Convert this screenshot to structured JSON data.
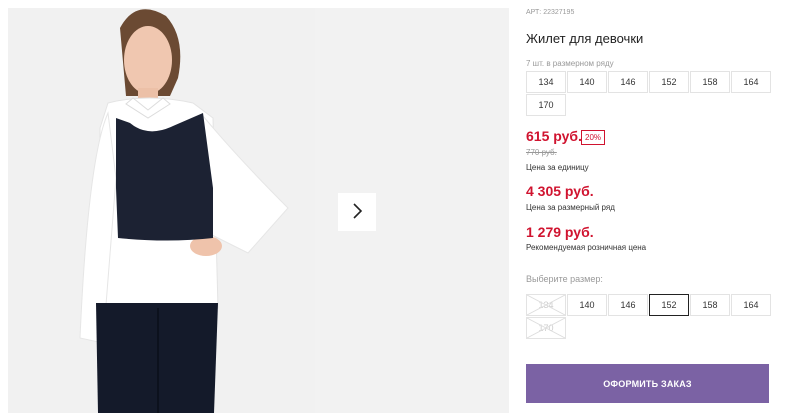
{
  "product": {
    "article": "АРТ: 22327195",
    "title": "Жилет для девочки",
    "series_note": "7 шт. в размерном ряду",
    "series_sizes": [
      "134",
      "140",
      "146",
      "152",
      "158",
      "164",
      "170"
    ]
  },
  "pricing": {
    "unit_price": "615 руб.",
    "discount": "20%",
    "old_price": "770 руб.",
    "unit_caption": "Цена за единицу",
    "series_price": "4 305 руб.",
    "series_caption": "Цена за размерный ряд",
    "retail_price": "1 279 руб.",
    "retail_caption": "Рекомендуемая розничная цена"
  },
  "size_picker": {
    "label": "Выберите размер:",
    "options": [
      {
        "value": "134",
        "available": false
      },
      {
        "value": "140",
        "available": true
      },
      {
        "value": "146",
        "available": true
      },
      {
        "value": "152",
        "available": true,
        "selected": true
      },
      {
        "value": "158",
        "available": true
      },
      {
        "value": "164",
        "available": true
      },
      {
        "value": "170",
        "available": false
      }
    ]
  },
  "actions": {
    "order_label": "ОФОРМИТЬ ЗАКАЗ"
  },
  "gallery": {
    "next_icon": "chevron-right-icon"
  },
  "colors": {
    "accent": "#7b62a4",
    "price": "#d0132f",
    "vest": "#1c2233"
  }
}
